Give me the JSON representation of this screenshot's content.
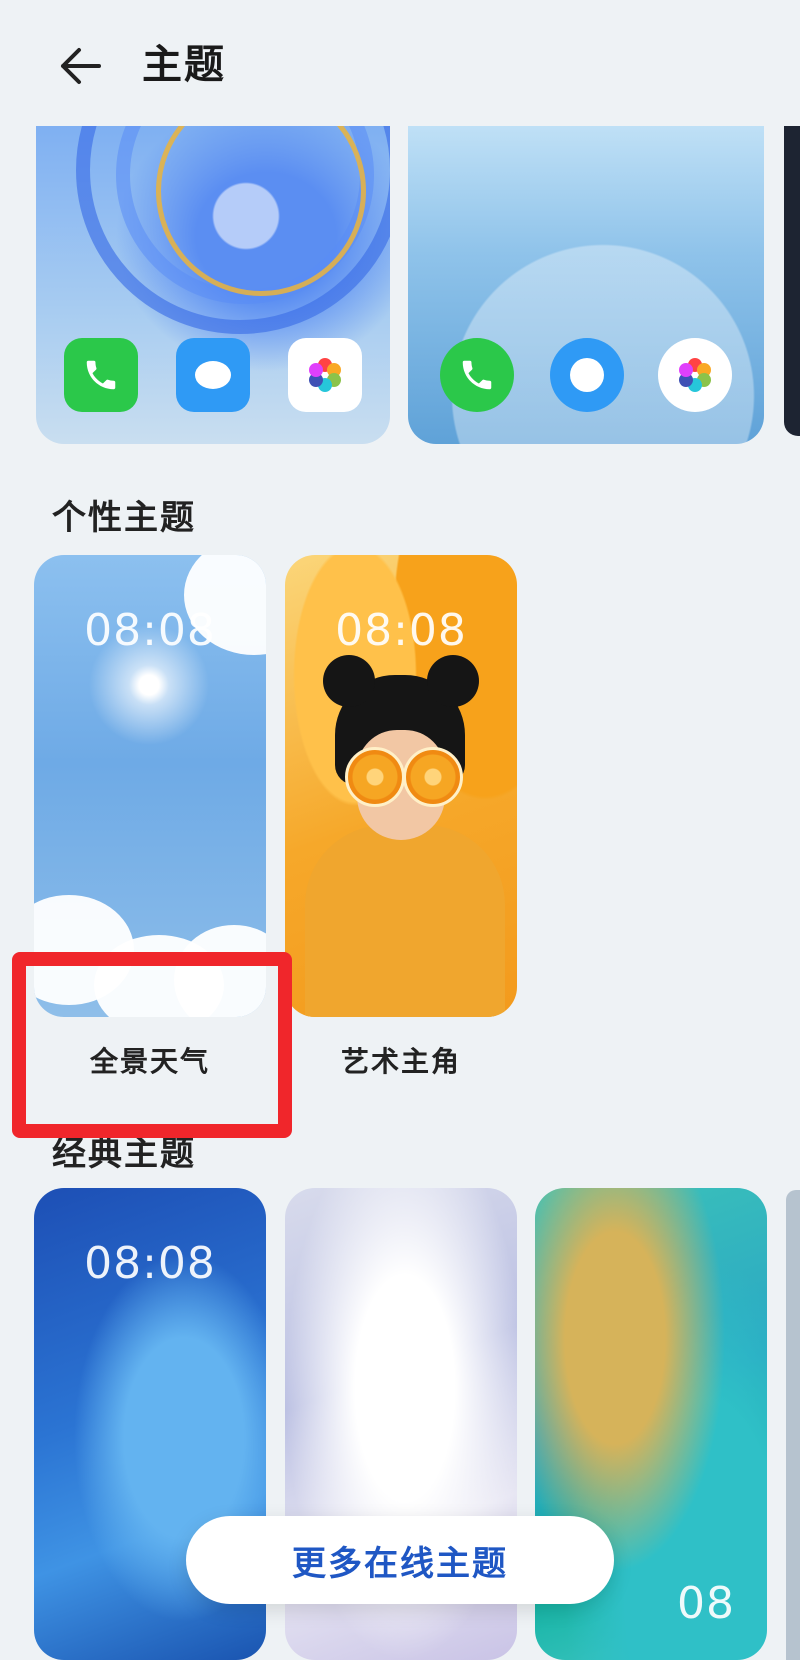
{
  "header": {
    "title": "主题",
    "back_icon": "arrow-left-icon"
  },
  "top_themes": [
    {
      "icons": [
        "phone-icon",
        "message-icon",
        "gallery-icon"
      ]
    },
    {
      "icons": [
        "phone-icon",
        "message-icon",
        "gallery-icon"
      ]
    }
  ],
  "sections": {
    "personal": {
      "title": "个性主题",
      "themes": [
        {
          "name": "全景天气",
          "clock": "08:08"
        },
        {
          "name": "艺术主角",
          "clock": "08:08"
        }
      ]
    },
    "classic": {
      "title": "经典主题",
      "themes": [
        {
          "clock": "08:08"
        },
        {
          "clock": ""
        },
        {
          "clock": "08"
        }
      ]
    }
  },
  "more_online_button": "更多在线主题",
  "colors": {
    "highlight": "#f0262b",
    "button_text": "#1f57c4",
    "background": "#eef2f5"
  }
}
